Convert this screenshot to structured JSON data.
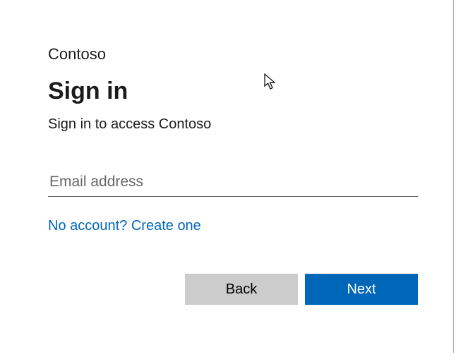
{
  "brand": "Contoso",
  "title": "Sign in",
  "subtitle": "Sign in to access Contoso",
  "email": {
    "placeholder": "Email address",
    "value": ""
  },
  "create_account_link": "No account? Create one",
  "buttons": {
    "back": "Back",
    "next": "Next"
  },
  "colors": {
    "accent": "#0067b8",
    "secondary_button": "#cccccc"
  }
}
